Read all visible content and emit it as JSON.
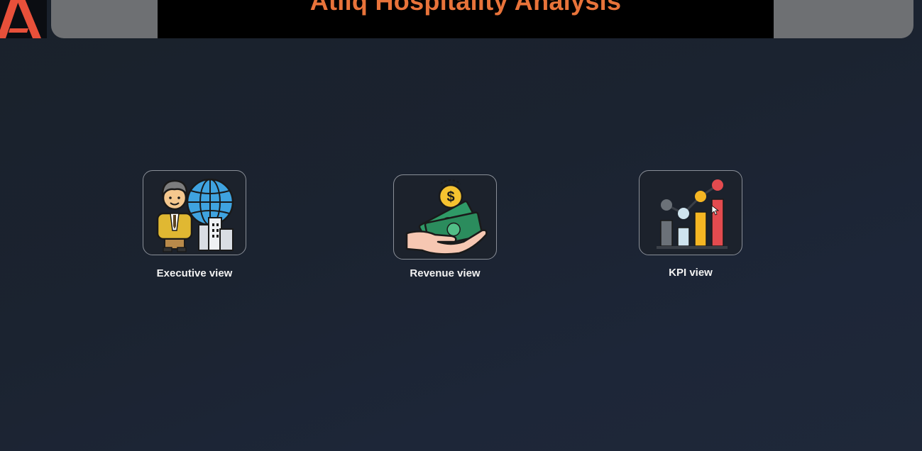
{
  "header": {
    "title": "Atliq Hospitality Analysis"
  },
  "colors": {
    "title": "#e8733a",
    "logo_accent": "#e8503a"
  },
  "nav": {
    "items": [
      {
        "label": "Executive view",
        "icon": "executive-globe-icon"
      },
      {
        "label": "Revenue view",
        "icon": "money-hand-icon"
      },
      {
        "label": "KPI view",
        "icon": "bar-chart-icon"
      }
    ]
  }
}
